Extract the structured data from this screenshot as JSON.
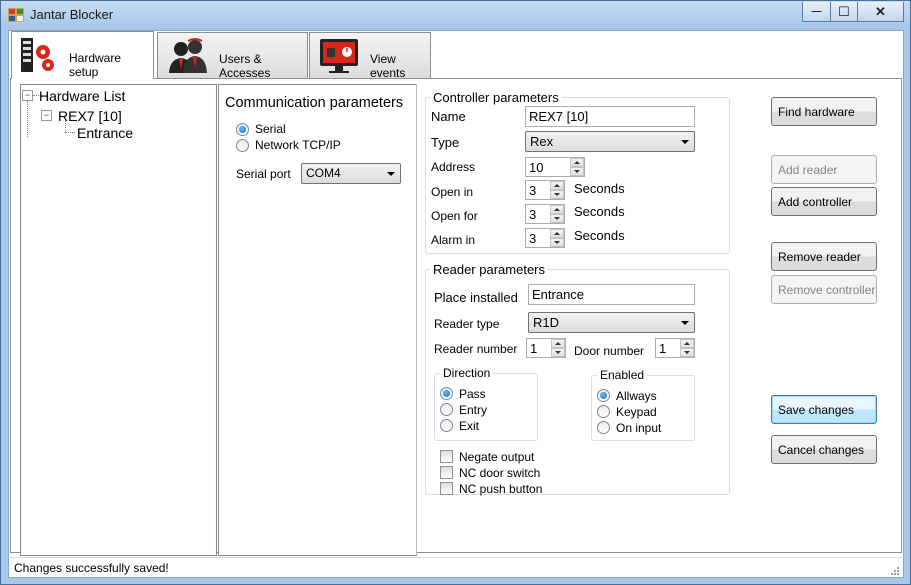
{
  "window": {
    "title": "Jantar Blocker",
    "minimize_glyph": "—",
    "maximize_glyph": "☐",
    "close_glyph": "✕"
  },
  "tabs": [
    {
      "label": "Hardware setup",
      "icon": "hardware-icon"
    },
    {
      "label": "Users & Accesses",
      "icon": "users-icon"
    },
    {
      "label": "View events",
      "icon": "events-monitor-icon"
    }
  ],
  "tree": {
    "root": "Hardware List",
    "controller": "REX7 [10]",
    "reader": "Entrance",
    "expander_glyph": "⊟"
  },
  "comm": {
    "title": "Communication parameters",
    "serial_label": "Serial",
    "network_label": "Network TCP/IP",
    "serial_port_label": "Serial port",
    "serial_port_value": "COM4"
  },
  "controller": {
    "title": "Controller parameters",
    "name_label": "Name",
    "name_value": "REX7 [10]",
    "type_label": "Type",
    "type_value": "Rex",
    "address_label": "Address",
    "address_value": "10",
    "open_in_label": "Open in",
    "open_in_value": "3",
    "open_for_label": "Open for",
    "open_for_value": "3",
    "alarm_in_label": "Alarm in",
    "alarm_in_value": "3",
    "seconds_label": "Seconds"
  },
  "reader": {
    "title": "Reader parameters",
    "place_label": "Place installed",
    "place_value": "Entrance",
    "type_label": "Reader type",
    "type_value": "R1D",
    "number_label": "Reader number",
    "number_value": "1",
    "door_label": "Door number",
    "door_value": "1",
    "direction": {
      "title": "Direction",
      "pass": "Pass",
      "entry": "Entry",
      "exit": "Exit"
    },
    "enabled": {
      "title": "Enabled",
      "always": "Allways",
      "keypad": "Keypad",
      "on_input": "On input"
    },
    "negate_output": "Negate output",
    "nc_door_switch": "NC door switch",
    "nc_push_button": "NC push button"
  },
  "buttons": {
    "find_hardware": "Find hardware",
    "add_reader": "Add reader",
    "add_controller": "Add controller",
    "remove_reader": "Remove reader",
    "remove_controller": "Remove controller",
    "save_changes": "Save changes",
    "cancel_changes": "Cancel changes"
  },
  "status": {
    "message": "Changes successfully saved!"
  }
}
